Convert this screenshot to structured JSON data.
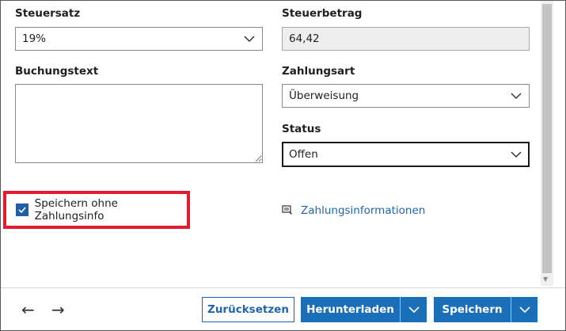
{
  "fields": {
    "steuersatz": {
      "label": "Steuersatz",
      "value": "19%"
    },
    "steuerbetrag": {
      "label": "Steuerbetrag",
      "value": "64,42"
    },
    "buchungstext": {
      "label": "Buchungstext",
      "value": ""
    },
    "zahlungsart": {
      "label": "Zahlungsart",
      "value": "Überweisung"
    },
    "status": {
      "label": "Status",
      "value": "Offen"
    }
  },
  "checkbox": {
    "label": "Speichern ohne Zahlungsinfo",
    "checked": true
  },
  "link": {
    "label": "Zahlungsinformationen",
    "icon": "payment-info-icon"
  },
  "footer": {
    "back_icon": "←",
    "forward_icon": "→",
    "reset_label": "Zurücksetzen",
    "download_label": "Herunterladen",
    "save_label": "Speichern"
  },
  "colors": {
    "primary": "#1a6fb8",
    "highlight": "#e21b2e",
    "link": "#1f64b0"
  }
}
